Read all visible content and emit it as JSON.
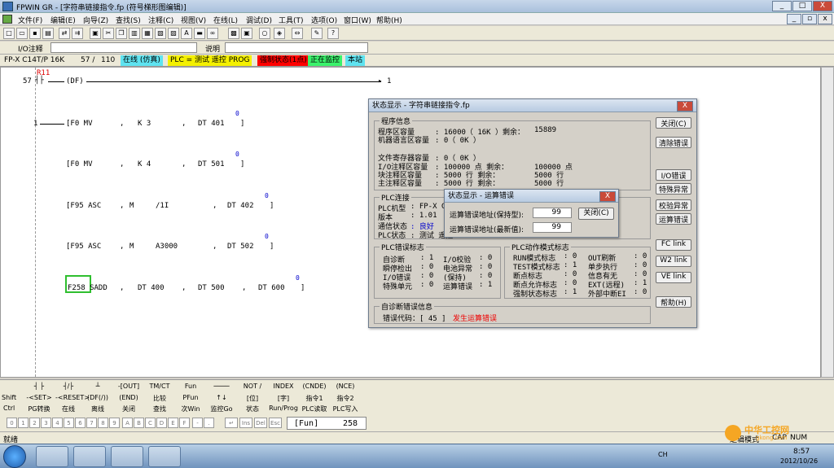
{
  "window": {
    "title": "FPWIN GR - [字符串链接指令.fp (符号梯形图编辑)]",
    "min": "_",
    "max": "□",
    "close": "X",
    "child_min": "_",
    "child_max": "▫",
    "child_close": "x"
  },
  "menu": [
    "文件(F)",
    "编辑(E)",
    "向导(Z)",
    "查找(S)",
    "注释(C)",
    "视图(V)",
    "在线(L)",
    "调试(D)",
    "工具(T)",
    "选项(O)",
    "窗口(W)",
    "帮助(H)"
  ],
  "comment_bar": {
    "io_label": "I/O注释",
    "desc_label": "说明"
  },
  "status_line": {
    "plc": "FP-X C14T/P 16K",
    "step": "57 /",
    "total": "110",
    "online": "在线 (仿真)",
    "plc_mode": "PLC = 测试 遥控 PROG",
    "error": "强制状态(1点)",
    "monitoring": "正在监控",
    "station": "本站"
  },
  "ladder": {
    "contact_label": "R11",
    "row1_num": "57",
    "df": "(DF)",
    "row1_end": "1",
    "row2_num": "1",
    "instructions": [
      {
        "text": "[F0 MV",
        "op1": "K 3",
        "op2": "DT 401",
        "close": "]",
        "mark": "0"
      },
      {
        "text": "[F0 MV",
        "op1": "K 4",
        "op2": "DT 501",
        "close": "]",
        "mark": "0"
      },
      {
        "text": "[F95 ASC",
        "op1": "M",
        "op2": "/1I",
        "op3": "DT 402",
        "close": "]",
        "mark": "0"
      },
      {
        "text": "[F95 ASC",
        "op1": "M",
        "op2": "A3000",
        "op3": "DT 502",
        "close": "]",
        "mark": "0"
      },
      {
        "text": "F258 SADD",
        "op1": "DT 400",
        "op2": "DT 500",
        "op3": "DT 600",
        "close": "]",
        "mark": "0"
      }
    ]
  },
  "status_dialog": {
    "title": "状态显示 - 字符串链接指令.fp",
    "close_x": "X",
    "program_info_label": "程序信息",
    "prog_area_label": "程序区容量",
    "prog_area_value": ": 16000（ 16K ）剩余：",
    "prog_area_remain": "15889",
    "machine_lang_label": "机器语言区容量",
    "machine_lang_value": ":     0（  0K ）",
    "file_reg_label": "文件寄存器容量",
    "file_reg_value": ":     0（  0K ）",
    "io_comment_label": "I/O注释区容量",
    "io_comment_value": ": 100000 点    剩余：",
    "io_comment_remain": "100000 点",
    "block_comment_label": "块注释区容量",
    "block_comment_value": ":   5000 行    剩余：",
    "block_comment_remain": "5000 行",
    "main_comment_label": "主注释区容量",
    "main_comment_value": ":   5000 行    剩余：",
    "main_comment_remain": "5000 行",
    "plc_conn_label": "PLC连接",
    "plc_model_label": "PLC机型",
    "plc_model_value": ": FP-X C14",
    "version_label": "版本",
    "version_value": ": 1.01",
    "comm_label": "通信状态",
    "comm_value": ": 良好",
    "plc_state_label": "PLC状态",
    "plc_state_value": ": 测试 遥控",
    "plc_err_label": "PLC错误标志",
    "errs": [
      [
        "自诊断",
        ": 1",
        "I/O校验",
        ": 0"
      ],
      [
        "瞬停检出",
        ": 0",
        "电池异常",
        ": 0"
      ],
      [
        "I/O错误",
        ": 0",
        "(保持)",
        ": 0"
      ],
      [
        "特殊单元",
        ": 0",
        "运算错误",
        ": 1"
      ]
    ],
    "plc_mode_label": "PLC动作模式标志",
    "modes": [
      [
        "RUN模式标志",
        ": 0",
        "OUT刷新",
        ": 0"
      ],
      [
        "TEST模式标志",
        ": 1",
        "单步执行",
        ": 0"
      ],
      [
        "断点标志",
        ": 0",
        "信息有无",
        ": 0"
      ],
      [
        "断点允许标志",
        ": 0",
        "EXT(远程)",
        ": 1"
      ],
      [
        "强制状态标志",
        ": 1",
        "外部中断EI",
        ": 0"
      ]
    ],
    "diag_label": "自诊断错误信息",
    "err_code_label": "错误代码：[ 45 ]",
    "err_msg": "发生运算错误",
    "buttons": [
      "关闭(C)",
      "清除错误",
      "I/O错误",
      "特殊异常",
      "校验异常",
      "运算错误",
      "FC link",
      "W2 link",
      "VE link",
      "帮助(H)"
    ]
  },
  "sub_dialog": {
    "title": "状态显示 - 运算错误",
    "close_x": "X",
    "hold_label": "运算错误地址(保持型):",
    "hold_value": "99",
    "latest_label": "运算错误地址(最新值):",
    "latest_value": "99",
    "close_btn": "关闭(C)"
  },
  "fkey_rows": {
    "row1": [
      "┤ ├",
      "┤/├",
      "┴",
      "-[OUT]",
      "TM/CT",
      "Fun",
      "────",
      "NOT /",
      "INDEX",
      "(CNDE)",
      "(NCE)"
    ],
    "row2_label": "Shift",
    "row2": [
      "-<SET>",
      "-<RESET>",
      "(DF(/))",
      "(END)",
      "比较",
      "PFun",
      "↑↓",
      "[位]",
      "[字]",
      "指令1",
      "指令2"
    ],
    "row3_label": "Ctrl",
    "row3": [
      "PG转换",
      "在线",
      "离线",
      "关闭",
      "查找",
      "次Win",
      "监控Go",
      "状态",
      "Run/Prog",
      "PLC读取",
      "PLC写入"
    ]
  },
  "numkeys": [
    "0",
    "1",
    "2",
    "3",
    "4",
    "5",
    "6",
    "7",
    "8",
    "9",
    "A",
    "B",
    "C",
    "D",
    "E",
    "F",
    "-",
    "."
  ],
  "inskeys": [
    "↵",
    "Ins",
    "Del",
    "Esc"
  ],
  "fun_field": {
    "label": "[Fun]",
    "value": "258"
  },
  "statusbar": {
    "left": "就绪",
    "right": "逻辑模式",
    "caps": "CAP",
    "num": "NUM"
  },
  "watermark": {
    "line1": "中华工控网",
    "line2": "gkong.com"
  },
  "tray": {
    "lang": "CH",
    "time": "8:57",
    "date": "2012/10/26"
  }
}
